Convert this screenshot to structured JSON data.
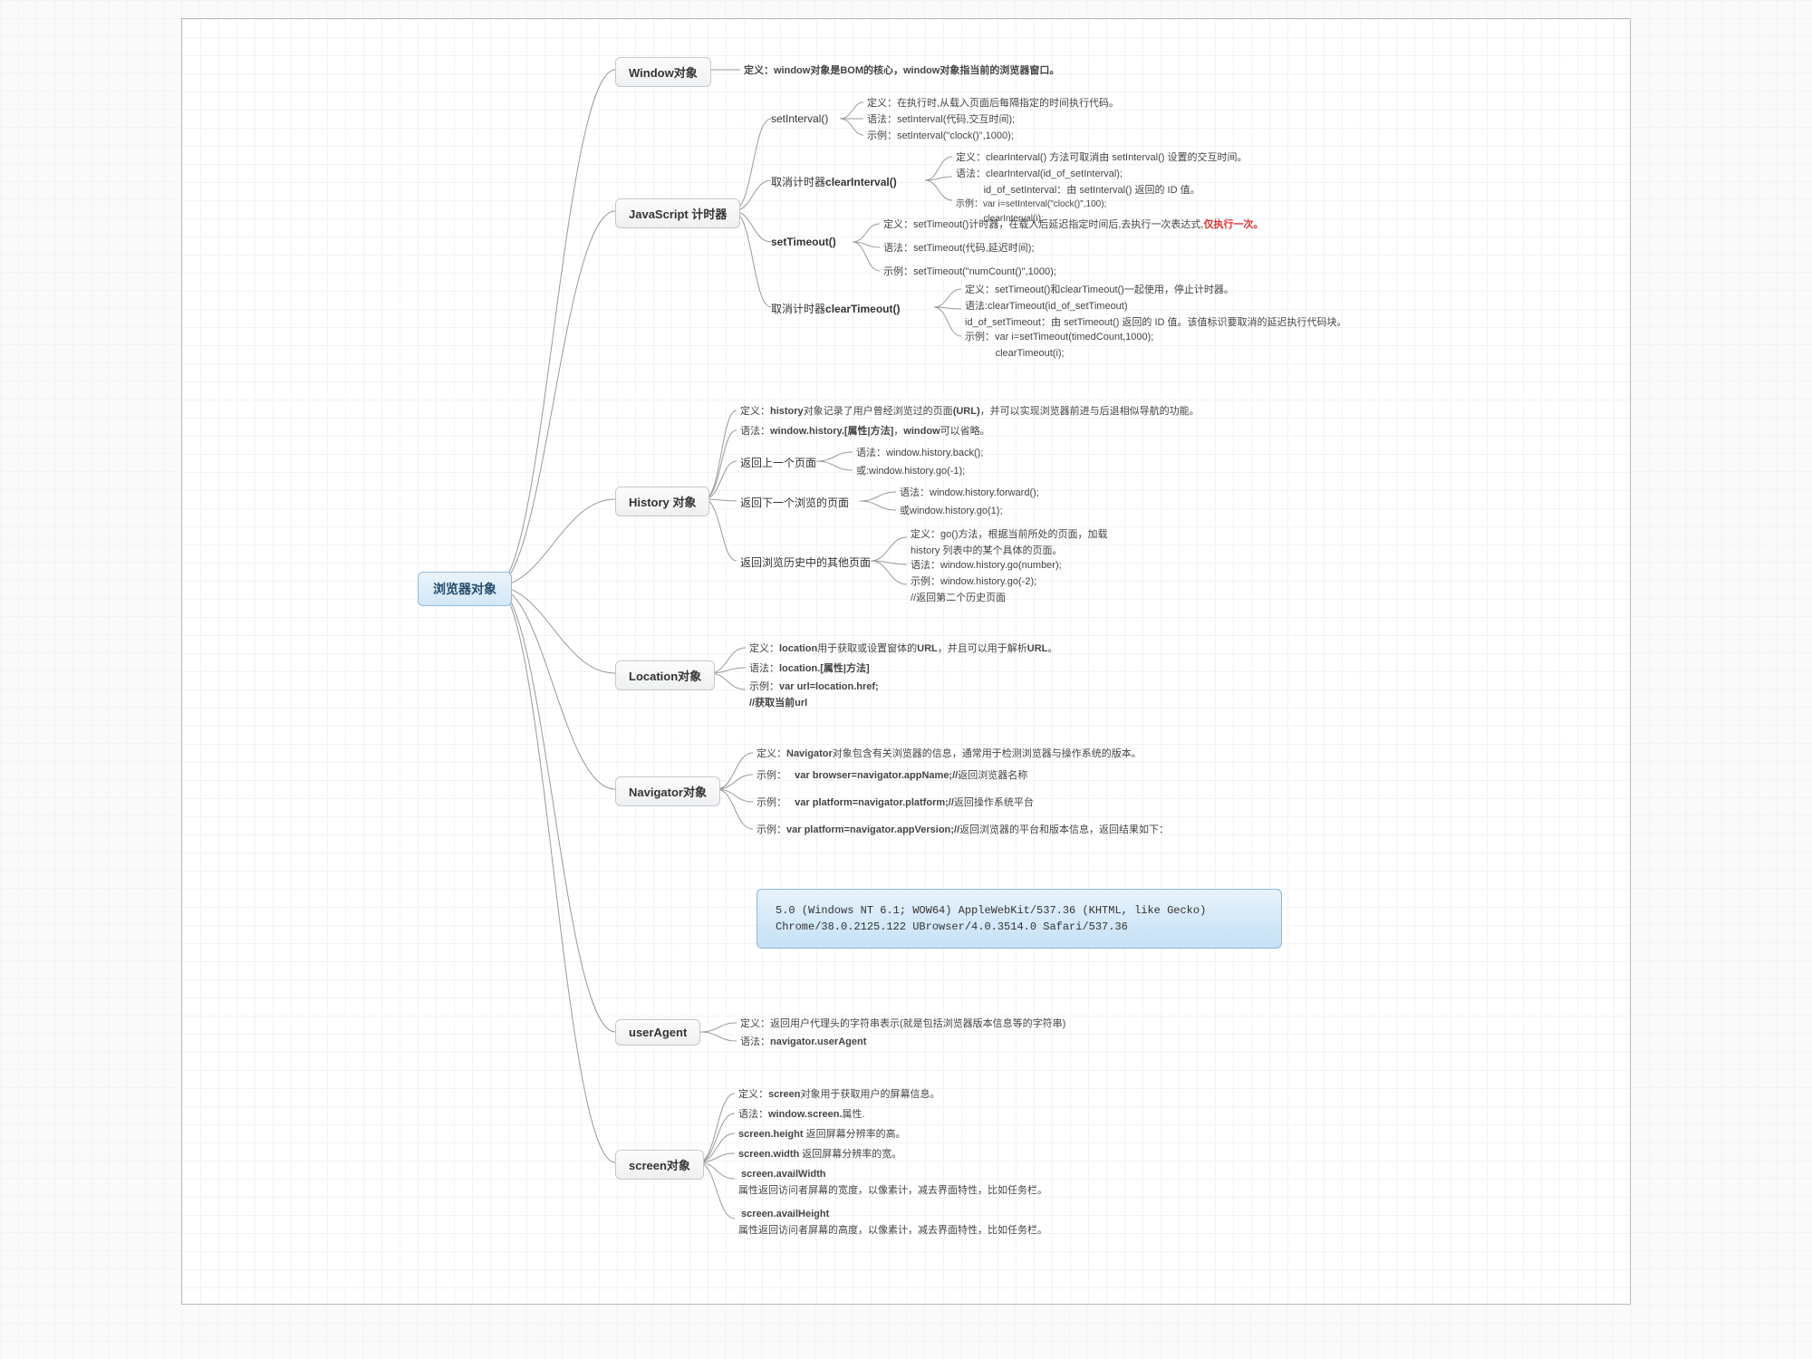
{
  "root": "浏览器对象",
  "mains": {
    "window": "Window对象",
    "timer": "JavaScript 计时器",
    "history": "History 对象",
    "location": "Location对象",
    "navigator": "Navigator对象",
    "userAgent": "userAgent",
    "screen": "screen对象"
  },
  "window_def": "定义：window对象是BOM的核心，window对象指当前的浏览器窗口。",
  "timer": {
    "setInterval": {
      "label": "setInterval()",
      "def": "定义：在执行时,从载入页面后每隔指定的时间执行代码。",
      "syntax": "语法：setInterval(代码,交互时间);",
      "example": "示例：setInterval(\"clock()\",1000);"
    },
    "clearInterval": {
      "label": "取消计时器clearInterval()",
      "def": "定义：clearInterval() 方法可取消由 setInterval() 设置的交互时间。",
      "syntax_main": "语法：clearInterval(id_of_setInterval);",
      "syntax_sub": "id_of_setInterval：由 setInterval() 返回的 ID 值。",
      "example": "示例：var i=setInterval(\"clock()\",100);\n           clearInterval(i);"
    },
    "setTimeout": {
      "label": "setTimeout()",
      "def_pre": "定义：setTimeout()计时器，在载入后延迟指定时间后,去执行一次表达式,",
      "def_red": "仅执行一次。",
      "syntax": "语法：setTimeout(代码,延迟时间);",
      "example": "示例：setTimeout(\"numCount()\",1000);"
    },
    "clearTimeout": {
      "label": "取消计时器clearTimeout()",
      "def": "定义：setTimeout()和clearTimeout()一起使用，停止计时器。",
      "syntax": "语法:clearTimeout(id_of_setTimeout)\nid_of_setTimeout：由 setTimeout() 返回的 ID 值。该值标识要取消的延迟执行代码块。",
      "example": "示例：var i=setTimeout(timedCount,1000);\n           clearTimeout(i);"
    }
  },
  "history": {
    "def": "定义：history对象记录了用户曾经浏览过的页面(URL)，并可以实现浏览器前进与后退相似导航的功能。",
    "syntax": "语法：window.history.[属性|方法]，window可以省略。",
    "back": {
      "label": "返回上一个页面",
      "a": "语法：window.history.back();",
      "b": "或:window.history.go(-1);"
    },
    "forward": {
      "label": "返回下一个浏览的页面",
      "a": "语法：window.history.forward();",
      "b": "或window.history.go(1);"
    },
    "other": {
      "label": "返回浏览历史中的其他页面",
      "def": "定义：go()方法，根据当前所处的页面，加载\nhistory 列表中的某个具体的页面。",
      "syntax": "语法：window.history.go(number);",
      "example": "示例：window.history.go(-2);\n//返回第二个历史页面"
    }
  },
  "location": {
    "def": "定义：location用于获取或设置窗体的URL，并且可以用于解析URL。",
    "syntax": "语法：location.[属性|方法]",
    "example": "示例：var url=location.href;\n//获取当前url"
  },
  "navigator": {
    "def": "定义：Navigator对象包含有关浏览器的信息，通常用于检测浏览器与操作系统的版本。",
    "ex1": "示例：   var browser=navigator.appName;//返回浏览器名称",
    "ex2": "示例：   var platform=navigator.platform;//返回操作系统平台",
    "ex3": "示例：var platform=navigator.appVersion;//返回浏览器的平台和版本信息，返回结果如下："
  },
  "ua_box": "5.0 (Windows NT 6.1; WOW64) AppleWebKit/537.36 (KHTML, like Gecko)\nChrome/38.0.2125.122 UBrowser/4.0.3514.0 Safari/537.36",
  "userAgent": {
    "def": "定义：返回用户代理头的字符串表示(就是包括浏览器版本信息等的字符串)",
    "syntax": "语法：navigator.userAgent"
  },
  "screen": {
    "def": "定义：screen对象用于获取用户的屏幕信息。",
    "syntax": "语法：window.screen.属性.",
    "height": "screen.height 返回屏幕分辨率的高。",
    "width": "screen.width 返回屏幕分辨率的宽。",
    "availW": " screen.availWidth\n属性返回访问者屏幕的宽度，以像素计，减去界面特性，比如任务栏。",
    "availH": " screen.availHeight\n属性返回访问者屏幕的高度，以像素计，减去界面特性，比如任务栏。"
  }
}
